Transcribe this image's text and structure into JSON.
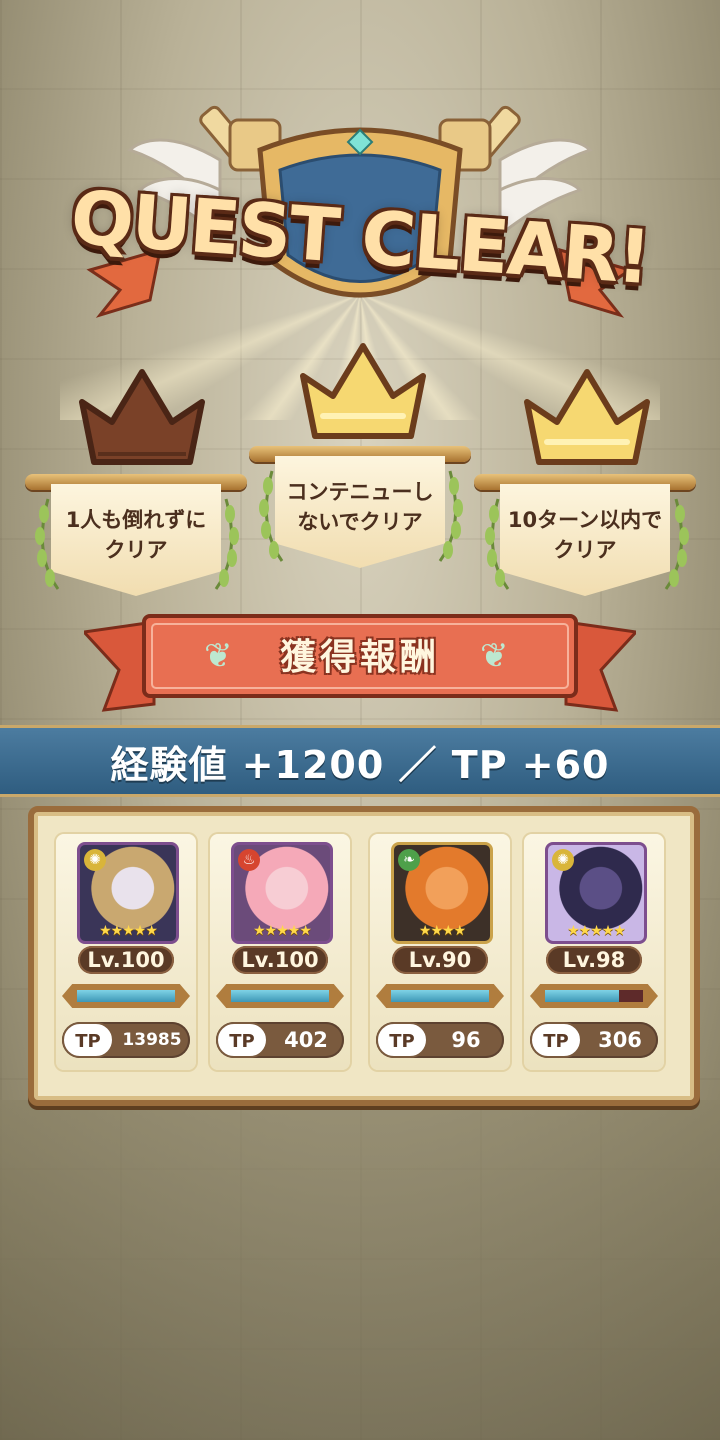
{
  "title": "QUEST CLEAR!",
  "missions": [
    {
      "text": "1人も倒れずにクリア",
      "achieved": false
    },
    {
      "text": "コンテニューしないでクリア",
      "achieved": true
    },
    {
      "text": "10ターン以内でクリア",
      "achieved": true
    }
  ],
  "rewards_label": "獲得報酬",
  "rewards_line": "経験値 +1200 ／ TP +60",
  "party": [
    {
      "element_icon": "light-icon",
      "level": "Lv.100",
      "hp_fraction": 1.0,
      "tp_label": "TP",
      "tp_value": "13985",
      "stars": "★★★★★",
      "frame_color": "#7d4e8e",
      "art": [
        "#e9e2ec",
        "#c9a870",
        "#3a3558"
      ]
    },
    {
      "element_icon": "fire-icon",
      "level": "Lv.100",
      "hp_fraction": 1.0,
      "tp_label": "TP",
      "tp_value": "402",
      "stars": "★★★★★",
      "frame_color": "#7d4e8e",
      "art": [
        "#f7cdd4",
        "#f5a9b8",
        "#6b4b7a"
      ]
    },
    {
      "element_icon": "leaf-icon",
      "level": "Lv.90",
      "hp_fraction": 1.0,
      "tp_label": "TP",
      "tp_value": "96",
      "stars": "★★★★",
      "frame_color": "#caa24a",
      "art": [
        "#f2a05a",
        "#e37a2c",
        "#3d3028"
      ]
    },
    {
      "element_icon": "light-icon",
      "level": "Lv.98",
      "hp_fraction": 0.75,
      "tp_label": "TP",
      "tp_value": "306",
      "stars": "★★★★★",
      "frame_color": "#7d4e8e",
      "art": [
        "#5b4f86",
        "#2f2a4d",
        "#c9b7e6"
      ]
    }
  ],
  "colors": {
    "bronze_crown": "#7a4128",
    "gold_crown": "#f6d871",
    "exp_bar": "#3e6d92"
  }
}
